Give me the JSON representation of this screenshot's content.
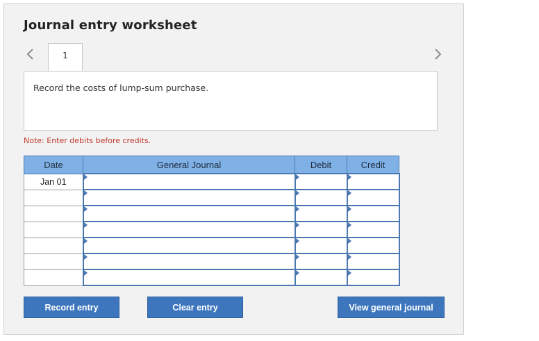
{
  "worksheet": {
    "title": "Journal entry worksheet",
    "tab_label": "1",
    "instruction": "Record the costs of lump-sum purchase.",
    "note": "Note: Enter debits before credits."
  },
  "table": {
    "headers": {
      "date": "Date",
      "general_journal": "General Journal",
      "debit": "Debit",
      "credit": "Credit"
    },
    "rows": [
      {
        "date": "Jan 01",
        "account": "",
        "debit": "",
        "credit": ""
      },
      {
        "date": "",
        "account": "",
        "debit": "",
        "credit": ""
      },
      {
        "date": "",
        "account": "",
        "debit": "",
        "credit": ""
      },
      {
        "date": "",
        "account": "",
        "debit": "",
        "credit": ""
      },
      {
        "date": "",
        "account": "",
        "debit": "",
        "credit": ""
      },
      {
        "date": "",
        "account": "",
        "debit": "",
        "credit": ""
      },
      {
        "date": "",
        "account": "",
        "debit": "",
        "credit": ""
      }
    ]
  },
  "buttons": {
    "record": "Record entry",
    "clear": "Clear entry",
    "view": "View general journal"
  },
  "icons": {
    "prev": "chevron-left-icon",
    "next": "chevron-right-icon"
  },
  "colors": {
    "header_bg": "#7fb0e6",
    "button_bg": "#3d76bd",
    "note_text": "#c0392b"
  }
}
